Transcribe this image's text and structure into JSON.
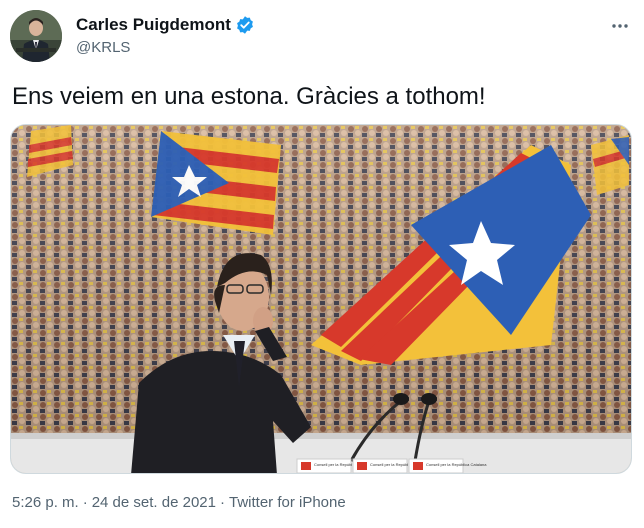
{
  "author": {
    "display_name": "Carles Puigdemont",
    "handle": "@KRLS",
    "verified": true,
    "verified_color": "#1d9bf0"
  },
  "tweet": {
    "text": "Ens veiem en una estona. Gràcies a tothom!"
  },
  "media": {
    "podium_signs": [
      "Consell per la República Catalana",
      "Consell per la República Catalana",
      "Consell per la República Catalana"
    ]
  },
  "meta": {
    "time": "5:26 p. m.",
    "separator": "·",
    "date": "24 de set. de 2021",
    "source": "Twitter for iPhone"
  },
  "icons": {
    "verified": "verified-badge-icon",
    "more": "more-options-icon"
  }
}
